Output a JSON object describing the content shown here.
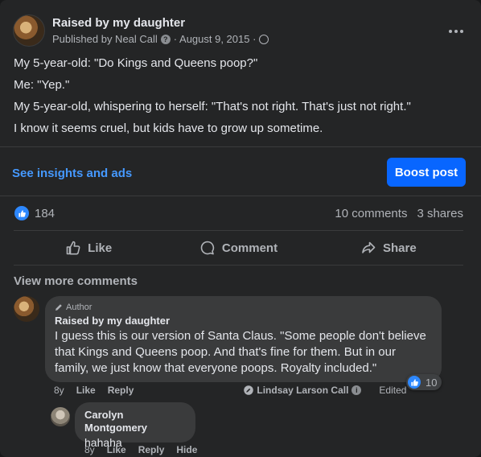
{
  "post": {
    "page_name": "Raised by my daughter",
    "published_by": "Published by Neal Call",
    "date": "· August 9, 2015 ·",
    "lines": [
      "My 5-year-old: \"Do Kings and Queens poop?\"",
      "Me: \"Yep.\"",
      "My 5-year-old, whispering to herself: \"That's not right. That's just not right.\"",
      "I know it seems cruel, but kids have to grow up sometime."
    ]
  },
  "insights": {
    "link_label": "See insights and ads",
    "boost_label": "Boost post"
  },
  "stats": {
    "likes": "184",
    "comments": "10 comments",
    "shares": "3 shares"
  },
  "actions": {
    "like": "Like",
    "comment": "Comment",
    "share": "Share"
  },
  "comments_section": {
    "view_more": "View more comments",
    "comment": {
      "author_badge": "Author",
      "name": "Raised by my daughter",
      "text": "I guess this is our version of Santa Claus. \"Some people don't believe that Kings and Queens poop. And that's fine for them. But in our family, we just know that everyone poops. Royalty included.\"",
      "time": "8y",
      "like": "Like",
      "reply": "Reply",
      "editor": "Lindsay Larson Call",
      "edited": "Edited",
      "reaction_count": "10"
    },
    "reply": {
      "name": "Carolyn Montgomery",
      "text": "hahaha",
      "time": "8y",
      "like": "Like",
      "reply": "Reply",
      "hide": "Hide"
    }
  },
  "colors": {
    "background": "#242526",
    "accent": "#0866ff",
    "link": "#4599ff",
    "like_blue": "#2d88ff"
  },
  "icons": [
    "info-icon",
    "globe-icon",
    "more-icon",
    "like-icon",
    "thumbs-up-icon",
    "comment-icon",
    "share-icon",
    "pencil-icon"
  ]
}
